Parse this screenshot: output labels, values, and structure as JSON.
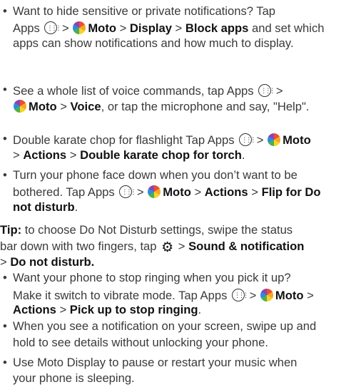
{
  "items": [
    {
      "lines": [
        [
          {
            "t": "Want to hide sensitive or private notifications? Tap"
          }
        ],
        [
          {
            "t": "Apps "
          },
          {
            "icon": "apps-icon"
          },
          {
            "t": " > "
          },
          {
            "icon": "moto-icon"
          },
          {
            "t": "Moto",
            "b": true
          },
          {
            "t": " > "
          },
          {
            "t": "Display",
            "b": true
          },
          {
            "t": " > "
          },
          {
            "t": "Block apps",
            "b": true
          },
          {
            "t": " and set which"
          }
        ],
        [
          {
            "t": "apps can show notifications and how much to display."
          }
        ]
      ]
    },
    {
      "lines": [
        [
          {
            "t": "See a whole list of voice commands, tap Apps "
          },
          {
            "icon": "apps-icon"
          },
          {
            "t": " >"
          }
        ],
        [
          {
            "icon": "moto-icon"
          },
          {
            "t": "Moto",
            "b": true
          },
          {
            "t": " > "
          },
          {
            "t": "Voice",
            "b": true
          },
          {
            "t": ", or tap the microphone and say, \"Help\"."
          }
        ]
      ]
    },
    {
      "lines": [
        [
          {
            "t": "Double karate chop for flashlight Tap Apps "
          },
          {
            "icon": "apps-icon"
          },
          {
            "t": " > "
          },
          {
            "icon": "moto-icon"
          },
          {
            "t": "Moto",
            "b": true
          }
        ],
        [
          {
            "t": "> "
          },
          {
            "t": "Actions",
            "b": true
          },
          {
            "t": " > "
          },
          {
            "t": "Double karate chop for torch",
            "b": true
          },
          {
            "t": "."
          }
        ]
      ]
    },
    {
      "lines": [
        [
          {
            "t": "Turn your phone face down when you don’t want to be"
          }
        ],
        [
          {
            "t": "bothered. Tap Apps "
          },
          {
            "icon": "apps-icon"
          },
          {
            "t": " > "
          },
          {
            "icon": "moto-icon"
          },
          {
            "t": "Moto",
            "b": true
          },
          {
            "t": " > "
          },
          {
            "t": "Actions",
            "b": true
          },
          {
            "t": " > "
          },
          {
            "t": "Flip for Do",
            "b": true
          }
        ],
        [
          {
            "t": "not disturb",
            "b": true
          },
          {
            "t": "."
          }
        ]
      ]
    },
    {
      "tip": true,
      "lines": [
        [
          {
            "t": "Tip:",
            "b": true
          },
          {
            "t": " to choose Do Not Disturb settings, swipe the status"
          }
        ],
        [
          {
            "t": "bar down with two fingers, tap "
          },
          {
            "icon": "gear-icon"
          },
          {
            "t": " > "
          },
          {
            "t": "Sound & notification",
            "b": true
          }
        ],
        [
          {
            "t": "> "
          },
          {
            "t": "Do not disturb.",
            "b": true
          }
        ]
      ]
    },
    {
      "lines": [
        [
          {
            "t": "Want your phone to stop ringing when you pick it up?"
          }
        ],
        [
          {
            "t": "Make it switch to vibrate mode. Tap Apps "
          },
          {
            "icon": "apps-icon"
          },
          {
            "t": " > "
          },
          {
            "icon": "moto-icon"
          },
          {
            "t": "Moto",
            "b": true
          },
          {
            "t": " >"
          }
        ],
        [
          {
            "t": "Actions",
            "b": true
          },
          {
            "t": " > "
          },
          {
            "t": "Pick up to stop ringing",
            "b": true
          },
          {
            "t": "."
          }
        ]
      ]
    },
    {
      "lines": [
        [
          {
            "t": "When you see a notification on your screen, swipe up and"
          }
        ],
        [
          {
            "t": "hold to see details without unlocking your phone."
          }
        ]
      ]
    },
    {
      "lines": [
        [
          {
            "t": "Use Moto Display to pause or restart your music when"
          }
        ],
        [
          {
            "t": "your phone is sleeping."
          }
        ]
      ]
    }
  ]
}
